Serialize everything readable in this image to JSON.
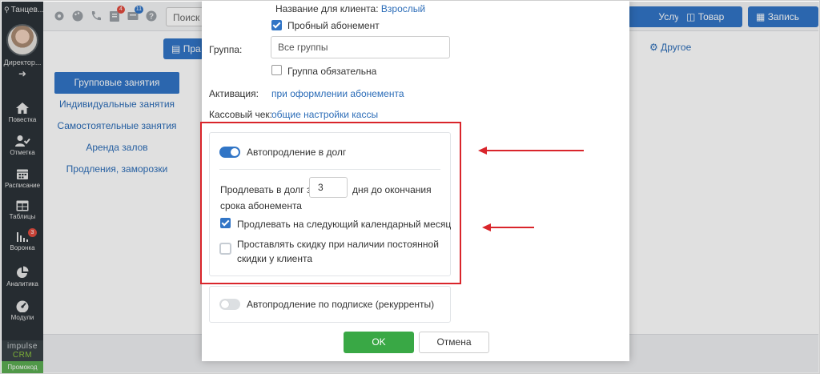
{
  "sidebar": {
    "org": "Танцев...",
    "role": "Директор...",
    "items": [
      {
        "label": "Повестка",
        "icon": "home-icon"
      },
      {
        "label": "Отметка",
        "icon": "user-check-icon"
      },
      {
        "label": "Расписание",
        "icon": "calendar-icon"
      },
      {
        "label": "Таблицы",
        "icon": "table-icon"
      },
      {
        "label": "Воронка",
        "icon": "funnel-icon",
        "badge": "3"
      },
      {
        "label": "Аналитика",
        "icon": "pie-chart-icon"
      },
      {
        "label": "Модули",
        "icon": "dashboard-icon"
      }
    ],
    "brand_top": "impulse",
    "brand_bottom": "CRM",
    "promo": "Промокод"
  },
  "topbar": {
    "search_placeholder": "Поиск",
    "badge_tasks": "4",
    "badge_messages": "11",
    "btn_service": "Услуга",
    "btn_product": "Товар",
    "btn_record": "Запись"
  },
  "content": {
    "tab_primary": "Пра",
    "tab_other": "Другое",
    "left_menu": [
      {
        "label": "Групповые занятия",
        "active": true
      },
      {
        "label": "Индивидуальные занятия",
        "active": false
      },
      {
        "label": "Самостоятельные занятия",
        "active": false
      },
      {
        "label": "Аренда залов",
        "active": false
      },
      {
        "label": "Продления, заморозки",
        "active": false
      }
    ]
  },
  "modal": {
    "client_name_label": "Название для клиента:",
    "client_name_value": "Взрослый",
    "trial_label": "Пробный абонемент",
    "trial_checked": true,
    "group_label": "Группа:",
    "group_placeholder": "Все группы",
    "group_required_label": "Группа обязательна",
    "group_required_checked": false,
    "activation_label": "Активация:",
    "activation_value": "при оформлении абонемента",
    "receipt_label": "Кассовый чек:",
    "receipt_value": "общие настройки кассы",
    "autorenew": {
      "toggle_label": "Автопродление в долг",
      "toggle_on": true,
      "days_prefix": "Продлевать в долг за",
      "days_value": "3",
      "days_suffix": "дня до окончания",
      "days_suffix2": "срока абонемента",
      "next_month_label": "Продлевать на следующий календарный месяц",
      "next_month_checked": true,
      "discount_label_1": "Проставлять скидку при наличии постоянной",
      "discount_label_2": "скидки у клиента",
      "discount_checked": false
    },
    "subscription": {
      "toggle_label": "Автопродление по подписке (рекурренты)",
      "toggle_on": false
    },
    "ok_label": "OK",
    "cancel_label": "Отмена"
  },
  "colors": {
    "primary": "#3175c6",
    "ok": "#39a845",
    "annotation": "#d9252b",
    "sidebar_bg": "#2c3338"
  }
}
